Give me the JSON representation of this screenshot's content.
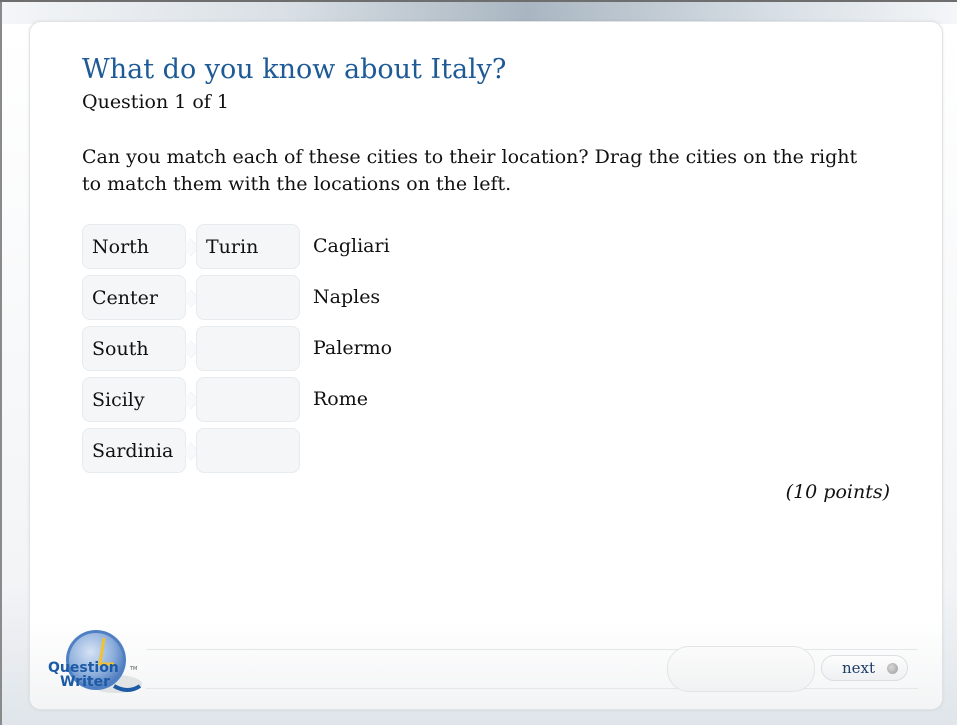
{
  "quiz": {
    "title": "What do you know about Italy?",
    "question_counter": "Question 1 of 1",
    "instructions": "Can you match each of these cities to their location? Drag the cities on the right to match them with the locations on the left.",
    "points": "(10 points)"
  },
  "matching": {
    "locations": [
      "North",
      "Center",
      "South",
      "Sicily",
      "Sardinia"
    ],
    "slots": [
      "Turin",
      "",
      "",
      "",
      ""
    ],
    "cities": [
      "Cagliari",
      "Naples",
      "Palermo",
      "Rome"
    ]
  },
  "footer": {
    "logo_line1": "Question",
    "logo_line2": "Writer",
    "logo_tm": "TM",
    "next_label": "next"
  },
  "colors": {
    "title": "#1e5a96",
    "logo_blue": "#1d5aa5",
    "logo_accent": "#f2c230"
  }
}
